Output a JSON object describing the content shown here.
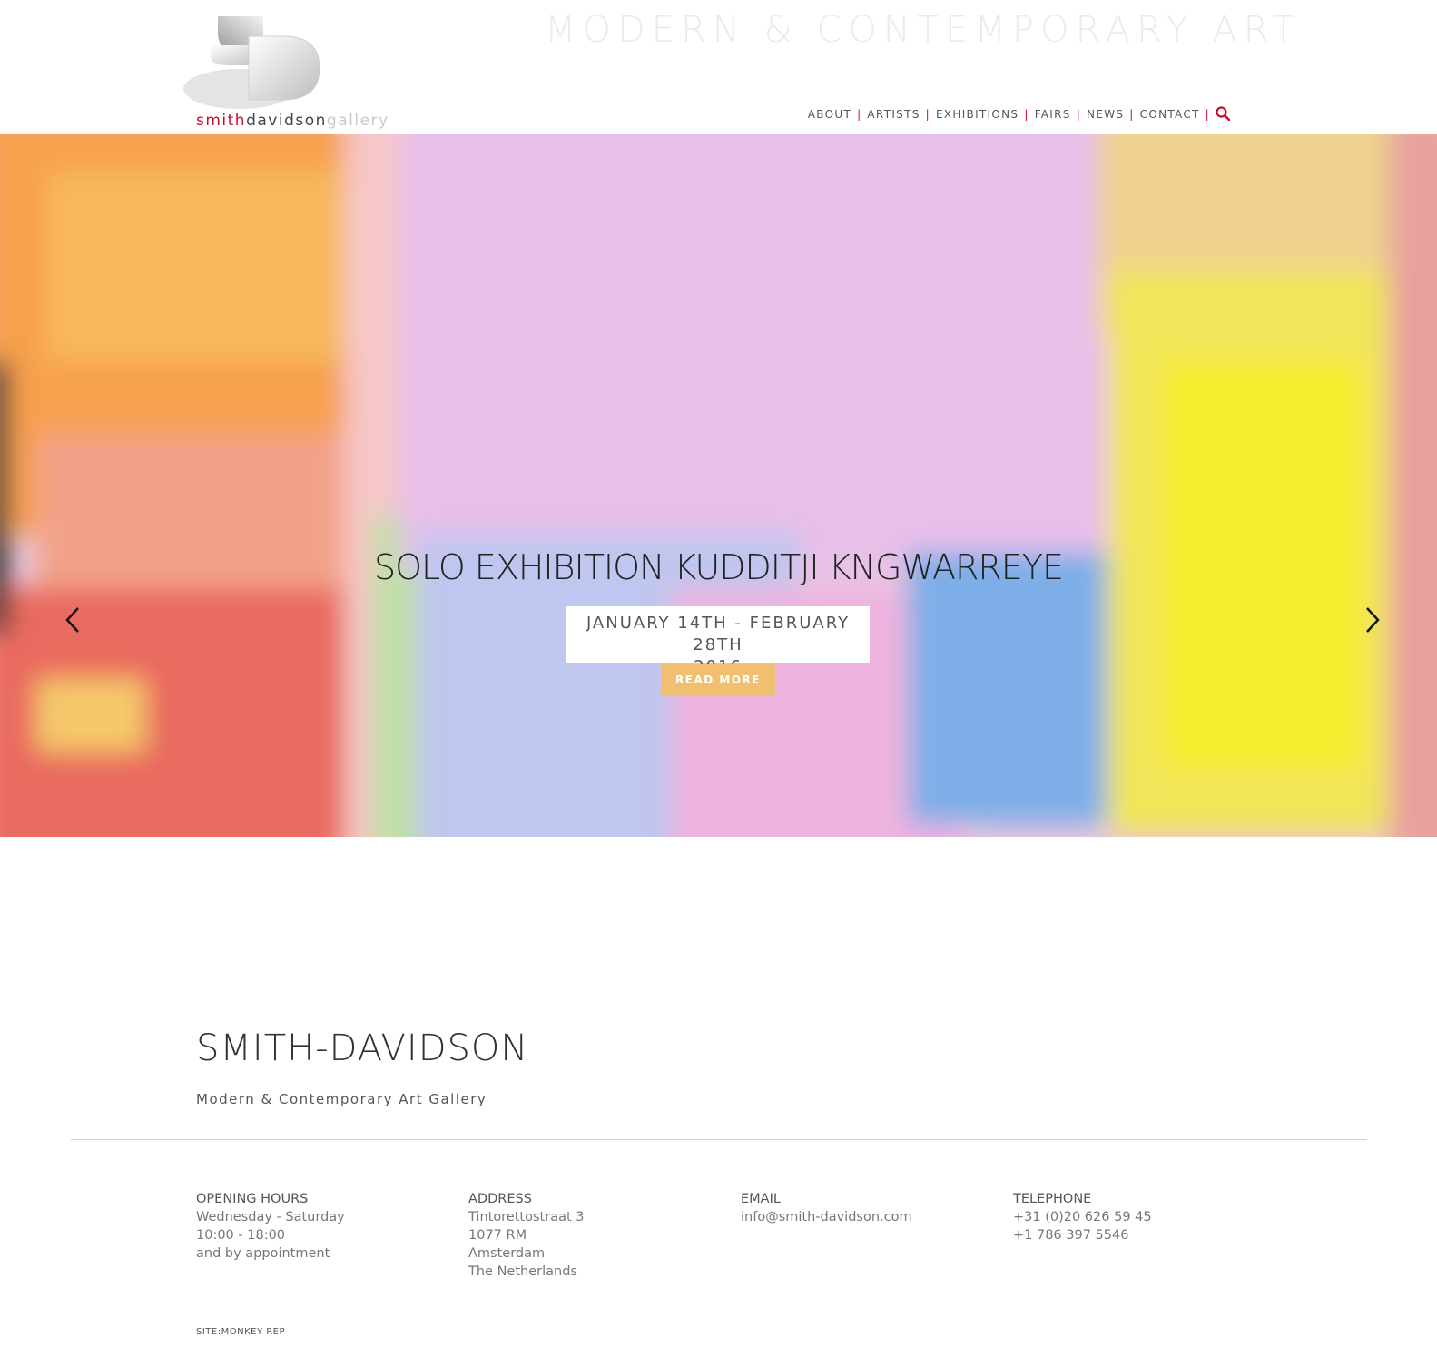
{
  "header": {
    "logo": {
      "part1": "smith",
      "part2": "davidson",
      "part3": "gallery"
    },
    "tagline": "MODERN & CONTEMPORARY ART",
    "nav": {
      "items": [
        "ABOUT",
        "ARTISTS",
        "EXHIBITIONS",
        "FAIRS",
        "NEWS",
        "CONTACT"
      ],
      "search_icon": "search-icon"
    },
    "colors": {
      "accent": "#c8102e"
    }
  },
  "hero": {
    "title": "SOLO EXHIBITION KUDDITJI KNGWARREYE",
    "date_line1": "JANUARY 14TH - FEBRUARY 28TH",
    "date_line2": "2016",
    "button": "READ MORE",
    "button_color": "#f0c070",
    "prev_icon": "chevron-left-icon",
    "next_icon": "chevron-right-icon"
  },
  "about": {
    "title": "SMITH-DAVIDSON",
    "subtitle": "Modern & Contemporary Art Gallery"
  },
  "footer": {
    "hours": {
      "heading": "OPENING HOURS",
      "lines": [
        "Wednesday - Saturday",
        "10:00 - 18:00",
        "and by appointment"
      ]
    },
    "address": {
      "heading": "ADDRESS",
      "lines": [
        "Tintorettostraat 3",
        "1077 RM",
        "Amsterdam",
        "The Netherlands"
      ]
    },
    "email": {
      "heading": "EMAIL",
      "lines": [
        "info@smith-davidson.com"
      ]
    },
    "telephone": {
      "heading": "TELEPHONE",
      "lines": [
        "+31 (0)20 626 59 45",
        "+1 786 397 5546"
      ]
    },
    "credit": "SITE:MONKEY REP"
  }
}
